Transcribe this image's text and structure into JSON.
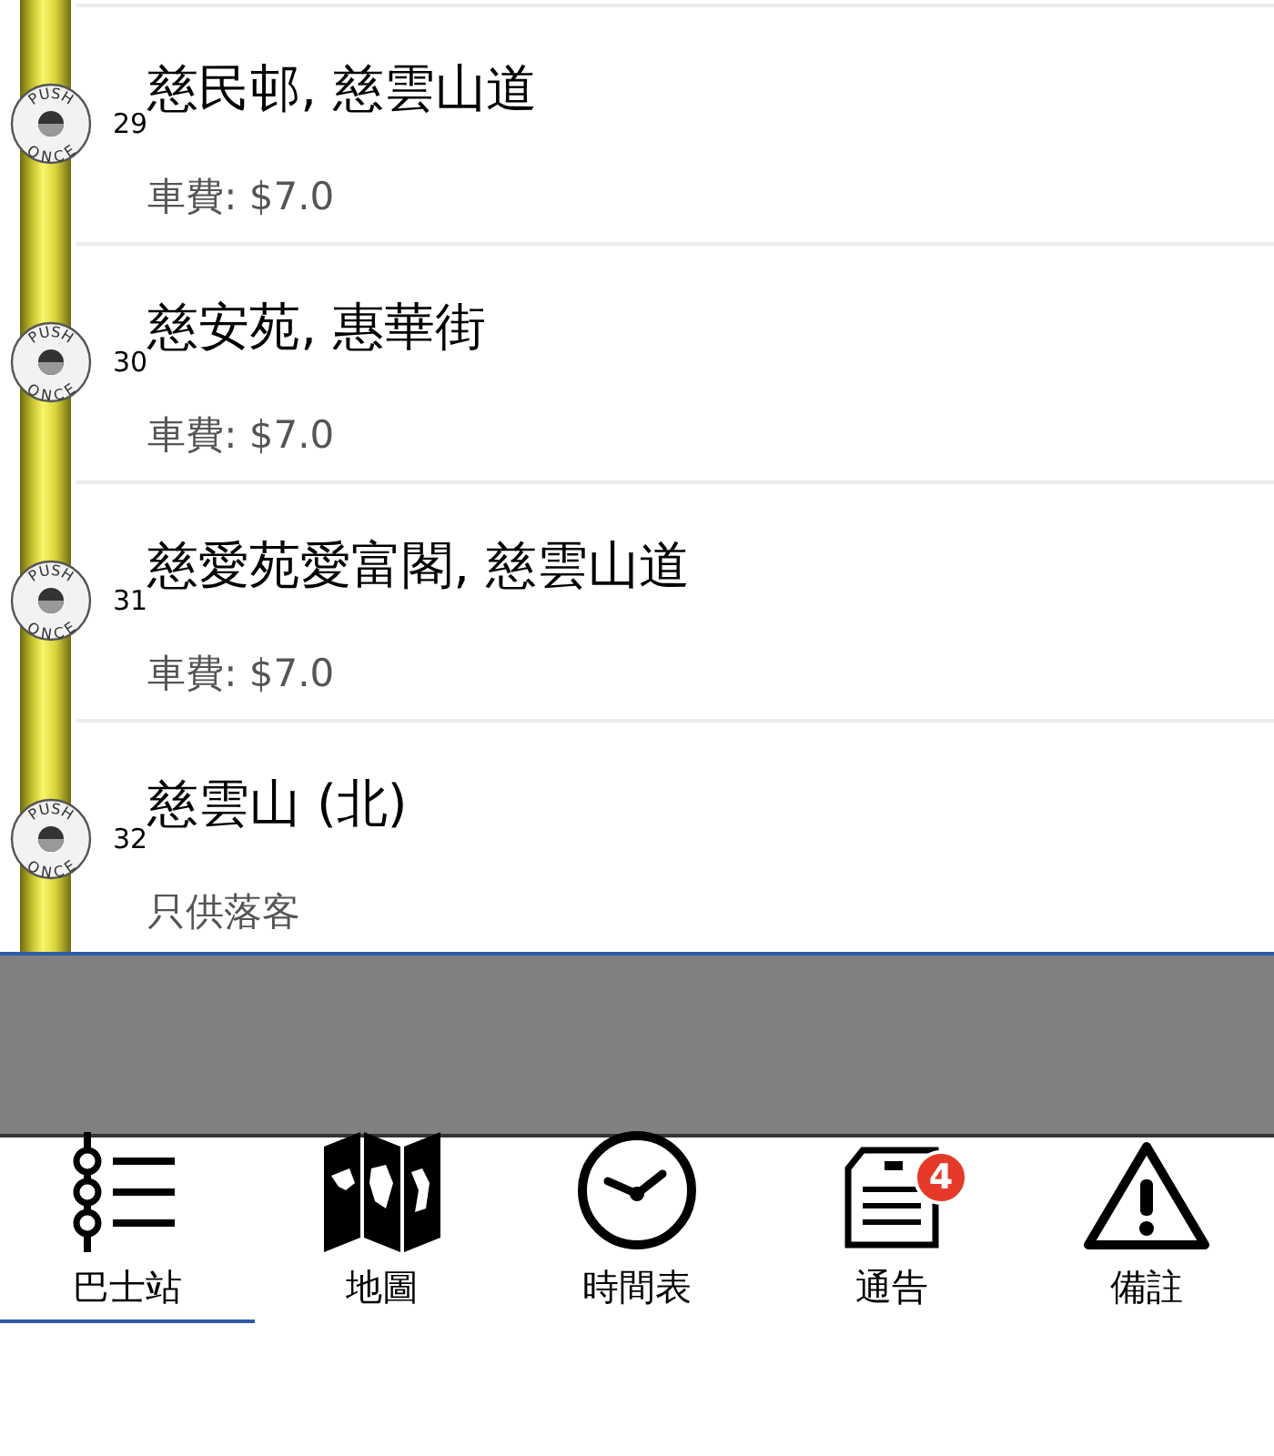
{
  "stops": [
    {
      "number": "29",
      "name": "慈民邨, 慈雲山道",
      "note": "車費: $7.0",
      "bell_top": "PUSH",
      "bell_bottom": "ONCE"
    },
    {
      "number": "30",
      "name": "慈安苑, 惠華街",
      "note": "車費: $7.0",
      "bell_top": "PUSH",
      "bell_bottom": "ONCE"
    },
    {
      "number": "31",
      "name": "慈愛苑愛富閣, 慈雲山道",
      "note": "車費: $7.0",
      "bell_top": "PUSH",
      "bell_bottom": "ONCE"
    },
    {
      "number": "32",
      "name": "慈雲山 (北)",
      "note": "只供落客",
      "bell_top": "PUSH",
      "bell_bottom": "ONCE"
    }
  ],
  "tabs": [
    {
      "label": "巴士站",
      "kind": "stops",
      "selected": true
    },
    {
      "label": "地圖",
      "kind": "map",
      "selected": false
    },
    {
      "label": "時間表",
      "kind": "timetable",
      "selected": false
    },
    {
      "label": "通告",
      "kind": "notices",
      "selected": false,
      "badge": "4"
    },
    {
      "label": "備註",
      "kind": "remarks",
      "selected": false
    }
  ]
}
